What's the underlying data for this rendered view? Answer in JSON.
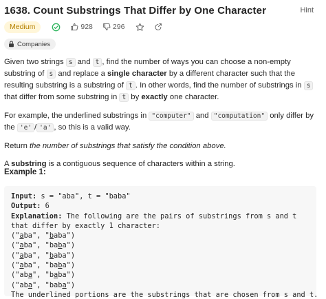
{
  "header": {
    "title": "1638. Count Substrings That Differ by One Character",
    "hint": "Hint"
  },
  "meta": {
    "difficulty": "Medium",
    "likes": "928",
    "dislikes": "296",
    "companies": "Companies"
  },
  "description": {
    "p1_a": "Given two strings ",
    "p1_s": "s",
    "p1_b": " and ",
    "p1_t": "t",
    "p1_c": ", find the number of ways you can choose a non-empty substring of ",
    "p1_s2": "s",
    "p1_d": " and replace a ",
    "p1_bold1": "single character",
    "p1_e": " by a different character such that the resulting substring is a substring of ",
    "p1_t2": "t",
    "p1_f": ". In other words, find the number of substrings in ",
    "p1_s3": "s",
    "p1_g": " that differ from some substring in ",
    "p1_t3": "t",
    "p1_h": " by ",
    "p1_bold2": "exactly",
    "p1_i": " one character.",
    "p2_a": "For example, the underlined substrings in ",
    "p2_code1": "\"computer\"",
    "p2_b": " and ",
    "p2_code2": "\"computation\"",
    "p2_c": " only differ by the ",
    "p2_code3": "'e'",
    "p2_slash": "/",
    "p2_code4": "'a'",
    "p2_d": ", so this is a valid way.",
    "p3_a": "Return ",
    "p3_em": "the number of substrings that satisfy the condition above.",
    "p4_bold": "substring",
    "p4_a": "A ",
    "p4_b": " is a contiguous sequence of characters within a string."
  },
  "example": {
    "title": "Example 1:",
    "input_label": "Input:",
    "input_value": " s = \"aba\", t = \"baba\"",
    "output_label": "Output:",
    "output_value": " 6",
    "explanation_label": "Explanation:",
    "explanation_value": " The following are the pairs of substrings from s and t that differ by exactly 1 character:",
    "pairs": [
      "(\"aba\", \"baba\")",
      "(\"aba\", \"baba\")",
      "(\"aba\", \"baba\")",
      "(\"aba\", \"baba\")",
      "(\"aba\", \"baba\")",
      "(\"aba\", \"baba\")"
    ],
    "footer": "The underlined portions are the substrings that are chosen from s and t."
  },
  "colors": {
    "medium_bg": "#fff6d9",
    "medium_text": "#b68100",
    "solved_green": "#2db55d"
  }
}
